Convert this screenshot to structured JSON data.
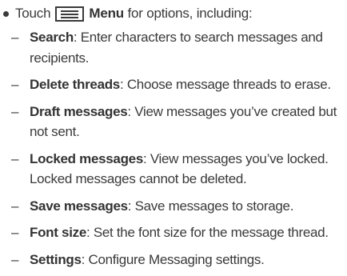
{
  "intro": {
    "before_icon": "Touch",
    "menu_label": "Menu",
    "after_menu": "for options, including:"
  },
  "icons": {
    "menu": "menu-icon"
  },
  "items": [
    {
      "title": "Search",
      "desc": ": Enter characters to search messages and recipients."
    },
    {
      "title": "Delete threads",
      "desc": ": Choose message threads to erase."
    },
    {
      "title": "Draft messages",
      "desc": ": View messages you’ve created but not sent."
    },
    {
      "title": "Locked messages",
      "desc": ": View messages you’ve locked. Locked messages cannot be deleted."
    },
    {
      "title": "Save messages",
      "desc": ": Save messages to storage."
    },
    {
      "title": "Font size",
      "desc": ": Set the font size for the message thread."
    },
    {
      "title": "Settings",
      "desc": ": Configure Messaging settings."
    }
  ],
  "dash": "–"
}
